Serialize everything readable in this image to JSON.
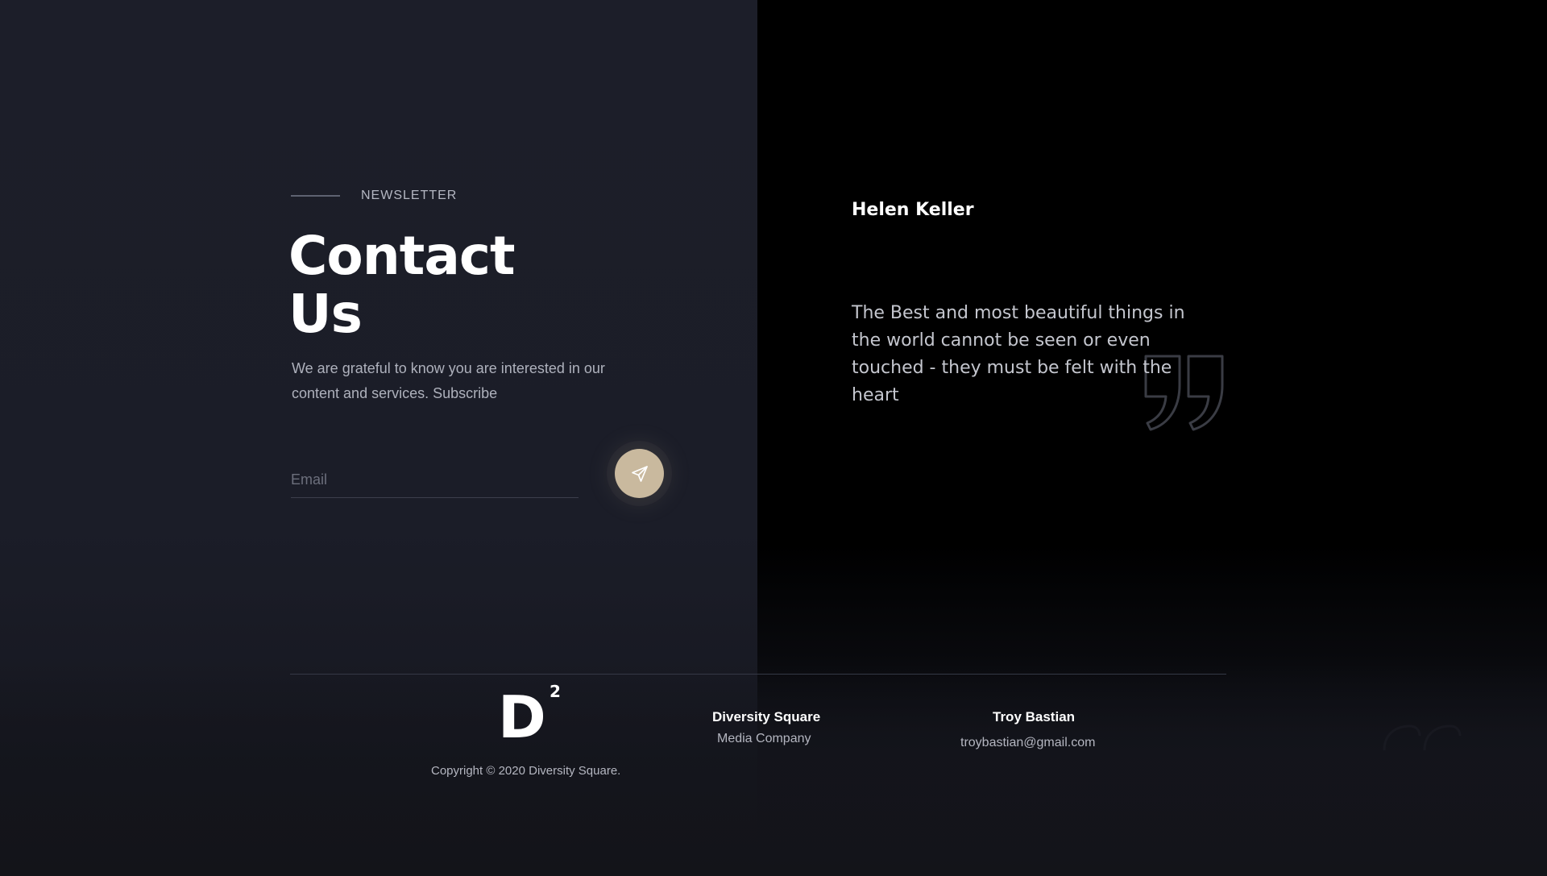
{
  "newsletter": {
    "eyebrow": "NEWSLETTER",
    "title_line1": "Contact",
    "title_line2": "Us",
    "description": "We are grateful to know you are interested in our content and services. Subscribe",
    "email_placeholder": "Email",
    "email_value": "",
    "send_icon": "paper-plane-icon"
  },
  "quote": {
    "author": "Helen Keller",
    "text": "The Best and most beautiful things in the world cannot be seen or even touched - they must be felt with the heart",
    "icon": "quote-icon"
  },
  "footer": {
    "logo_letter": "D",
    "logo_superscript": "2",
    "copyright": "Copyright © 2020 Diversity Square.",
    "company_name": "Diversity Square",
    "company_tagline": "Media Company",
    "contact_name": "Troy Bastian",
    "contact_email": "troybastian@gmail.com"
  },
  "colors": {
    "left_background": "#1b1d28",
    "right_background": "#000000",
    "accent": "#c9b99e",
    "text_primary": "#ffffff",
    "text_muted": "#aeb1bc"
  }
}
